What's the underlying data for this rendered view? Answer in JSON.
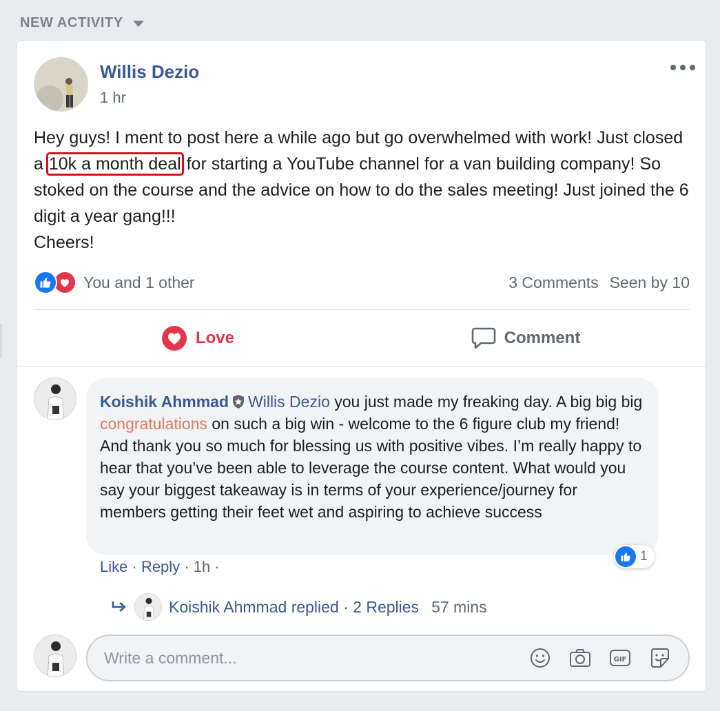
{
  "section": {
    "title": "NEW ACTIVITY"
  },
  "post": {
    "author": "Willis Dezio",
    "time": "1 hr",
    "text_before": "Hey guys! I ment to post here a while ago but go overwhelmed with work! Just closed a ",
    "text_highlight": "10k a month deal",
    "text_after": " for starting a YouTube channel for a van building company! So stoked on the course and the advice on how to do the sales meeting! Just joined the 6 digit a year gang!!!",
    "text_end": "Cheers!",
    "reactions_summary": "You and 1 other",
    "comments_count": "3 Comments",
    "seen_by": "Seen by 10",
    "love_label": "Love",
    "comment_label": "Comment"
  },
  "comment": {
    "author": "Koishik Ahmmad",
    "mention": "Willis Dezio",
    "text_1": " you just made my freaking day. A big big big ",
    "text_highlight": "congratulations",
    "text_2": " on such a big win - welcome to the 6 figure club my friend! And thank you so much for blessing us with positive vibes. I’m really happy to hear that you’ve been able to leverage the course content. What would you say your biggest takeaway is in terms of your experience/journey for members getting their feet wet and aspiring to achieve success",
    "like": "Like",
    "reply": "Reply",
    "sep": "·",
    "time": "1h",
    "like_count": "1"
  },
  "replies": {
    "text": "Koishik Ahmmad replied · 2 Replies",
    "time": "57 mins"
  },
  "composer": {
    "placeholder": "Write a comment..."
  },
  "colors": {
    "link": "#385898",
    "love": "#e4354a",
    "like": "#1877f2",
    "highlight_box": "#d0141e"
  },
  "icons": [
    "caret-down-icon",
    "more-icon",
    "like-reaction-icon",
    "love-reaction-icon",
    "heart-icon",
    "speech-bubble-icon",
    "badge-icon",
    "reply-arrow-icon",
    "emoji-icon",
    "camera-icon",
    "gif-icon",
    "sticker-icon"
  ]
}
